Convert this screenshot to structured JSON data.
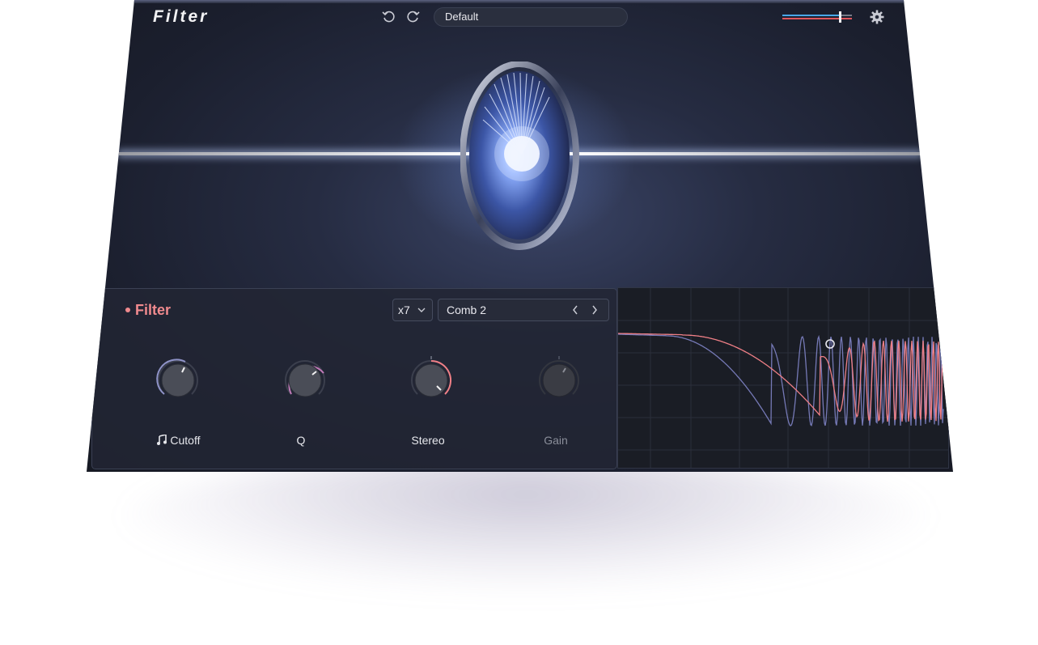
{
  "app": {
    "title": "Filter"
  },
  "toolbar": {
    "undo_icon": "undo-icon",
    "redo_icon": "redo-icon",
    "preset_name": "Default",
    "settings_icon": "gear-icon"
  },
  "module": {
    "title": "Filter",
    "multiplier": "x7",
    "mode": "Comb 2",
    "knobs": [
      {
        "label": "Cutoff",
        "icon": "music-note-icon"
      },
      {
        "label": "Q"
      },
      {
        "label": "Stereo"
      },
      {
        "label": "Gain"
      }
    ]
  },
  "colors": {
    "accent": "#f08a8e",
    "background": "#1b1f2e",
    "curve_primary": "#ef7f86",
    "curve_secondary": "#7f84c6"
  }
}
